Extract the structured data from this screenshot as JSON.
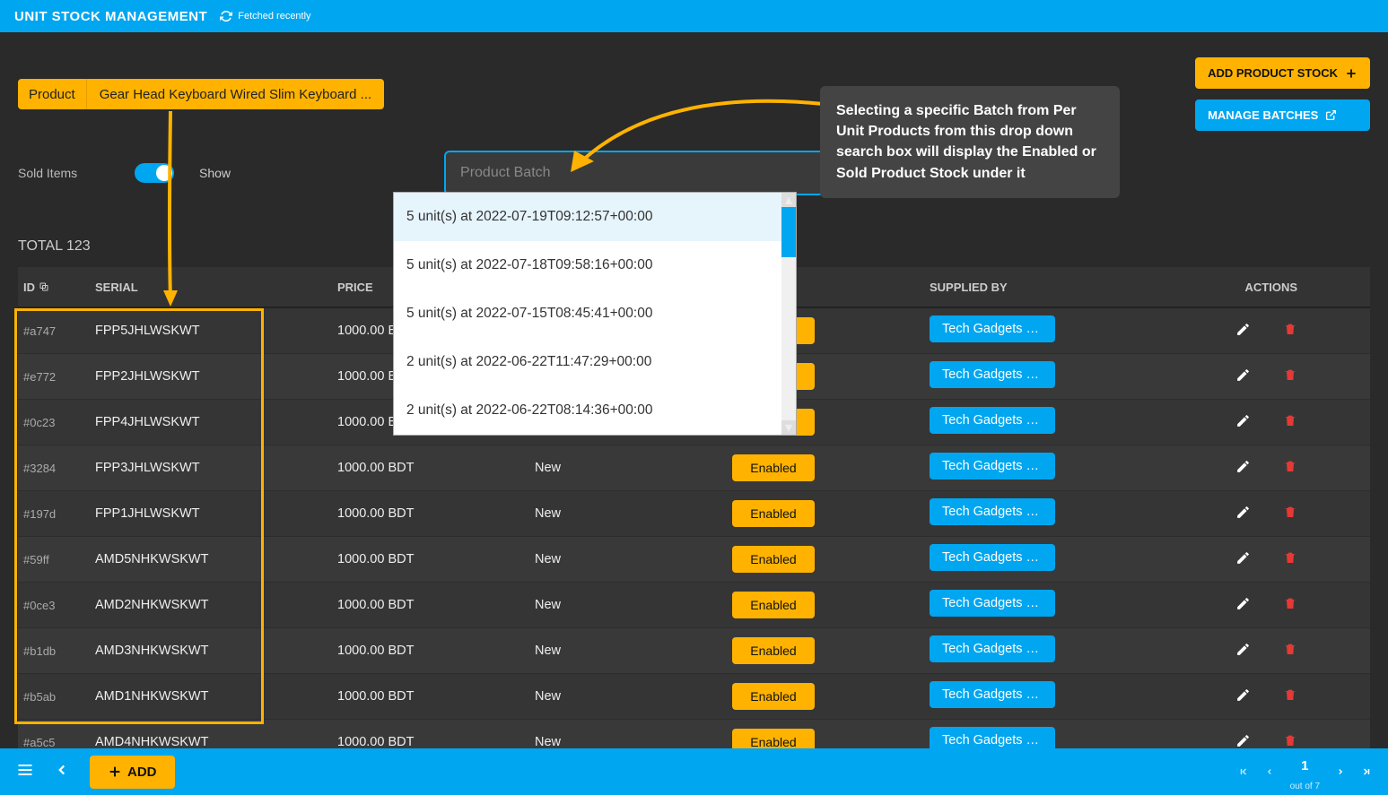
{
  "header": {
    "title": "UNIT STOCK MANAGEMENT",
    "fetched": "Fetched recently"
  },
  "product": {
    "label": "Product",
    "value": "Gear Head Keyboard Wired Slim Keyboard ..."
  },
  "buttons": {
    "add_stock": "ADD PRODUCT STOCK",
    "manage_batches": "MANAGE BATCHES",
    "add": "ADD"
  },
  "sold": {
    "label": "Sold Items",
    "show": "Show"
  },
  "batch": {
    "placeholder": "Product Batch",
    "options": [
      "5 unit(s) at 2022-07-19T09:12:57+00:00",
      "5 unit(s) at 2022-07-18T09:58:16+00:00",
      "5 unit(s) at 2022-07-15T08:45:41+00:00",
      "2 unit(s) at 2022-06-22T11:47:29+00:00",
      "2 unit(s) at 2022-06-22T08:14:36+00:00"
    ]
  },
  "tooltip": "Selecting a specific Batch from Per Unit Products from this drop down search box will display the Enabled or Sold Product Stock under it",
  "total": "TOTAL 123",
  "columns": {
    "id": "ID",
    "serial": "SERIAL",
    "price": "PRICE",
    "condition": "",
    "status": "",
    "supplied": "SUPPLIED BY",
    "actions": "ACTIONS"
  },
  "condition_label": "New",
  "status_label": "Enabled",
  "supplier_label": "Tech Gadgets Su...",
  "rows": [
    {
      "id": "#a747",
      "serial": "FPP5JHLWSKWT",
      "price": "1000.00 BDT"
    },
    {
      "id": "#e772",
      "serial": "FPP2JHLWSKWT",
      "price": "1000.00 BDT"
    },
    {
      "id": "#0c23",
      "serial": "FPP4JHLWSKWT",
      "price": "1000.00 BDT"
    },
    {
      "id": "#3284",
      "serial": "FPP3JHLWSKWT",
      "price": "1000.00 BDT"
    },
    {
      "id": "#197d",
      "serial": "FPP1JHLWSKWT",
      "price": "1000.00 BDT"
    },
    {
      "id": "#59ff",
      "serial": "AMD5NHKWSKWT",
      "price": "1000.00 BDT"
    },
    {
      "id": "#0ce3",
      "serial": "AMD2NHKWSKWT",
      "price": "1000.00 BDT"
    },
    {
      "id": "#b1db",
      "serial": "AMD3NHKWSKWT",
      "price": "1000.00 BDT"
    },
    {
      "id": "#b5ab",
      "serial": "AMD1NHKWSKWT",
      "price": "1000.00 BDT"
    },
    {
      "id": "#a5c5",
      "serial": "AMD4NHKWSKWT",
      "price": "1000.00 BDT"
    }
  ],
  "pager": {
    "current": "1",
    "outof": "out of 7"
  }
}
